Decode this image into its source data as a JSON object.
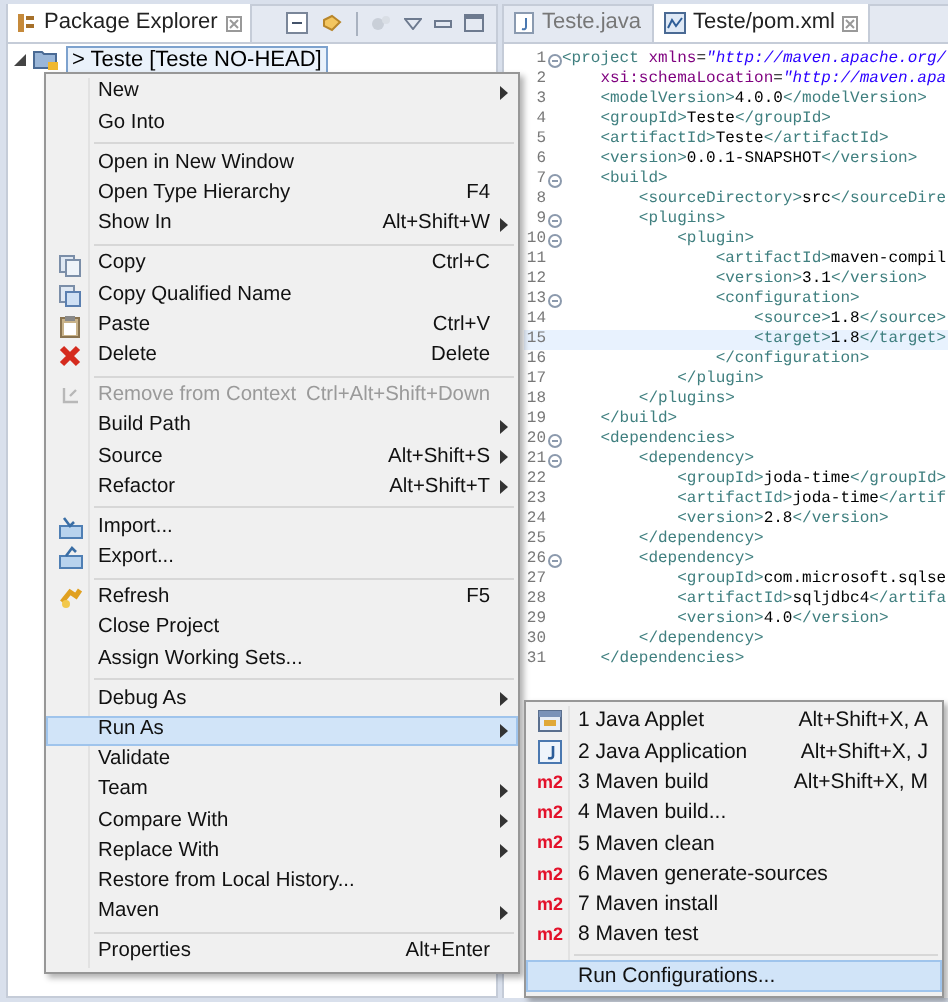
{
  "explorer": {
    "title": "Package Explorer",
    "tree": [
      {
        "label": "> Teste [Teste NO-HEAD]",
        "expanded": true,
        "selected": true
      }
    ]
  },
  "editor": {
    "tabs": [
      {
        "label": "Teste.java",
        "kind": "java",
        "selected": false
      },
      {
        "label": "Teste/pom.xml",
        "kind": "xml",
        "selected": true
      }
    ],
    "lines": [
      {
        "number": "1",
        "fold": true,
        "current": false,
        "tokens": [
          {
            "kind": "tag",
            "text": "<project"
          },
          {
            "kind": "attr",
            "text": " xmlns"
          },
          {
            "kind": "text",
            "text": "="
          },
          {
            "kind": "value",
            "text": "\"http://maven.apache.org/"
          }
        ]
      },
      {
        "number": "2",
        "fold": false,
        "current": false,
        "tokens": [
          {
            "kind": "attr",
            "text": "    xsi:schemaLocation"
          },
          {
            "kind": "text",
            "text": "="
          },
          {
            "kind": "value",
            "text": "\"http://maven.apa"
          }
        ]
      },
      {
        "number": "3",
        "fold": false,
        "current": false,
        "tokens": [
          {
            "kind": "tag",
            "text": "    <modelVersion>"
          },
          {
            "kind": "text",
            "text": "4.0.0"
          },
          {
            "kind": "tag",
            "text": "</modelVersion>"
          }
        ]
      },
      {
        "number": "4",
        "fold": false,
        "current": false,
        "tokens": [
          {
            "kind": "tag",
            "text": "    <groupId>"
          },
          {
            "kind": "text",
            "text": "Teste"
          },
          {
            "kind": "tag",
            "text": "</groupId>"
          }
        ]
      },
      {
        "number": "5",
        "fold": false,
        "current": false,
        "tokens": [
          {
            "kind": "tag",
            "text": "    <artifactId>"
          },
          {
            "kind": "text",
            "text": "Teste"
          },
          {
            "kind": "tag",
            "text": "</artifactId>"
          }
        ]
      },
      {
        "number": "6",
        "fold": false,
        "current": false,
        "tokens": [
          {
            "kind": "tag",
            "text": "    <version>"
          },
          {
            "kind": "text",
            "text": "0.0.1-SNAPSHOT"
          },
          {
            "kind": "tag",
            "text": "</version>"
          }
        ]
      },
      {
        "number": "7",
        "fold": true,
        "current": false,
        "tokens": [
          {
            "kind": "tag",
            "text": "    <build>"
          }
        ]
      },
      {
        "number": "8",
        "fold": false,
        "current": false,
        "tokens": [
          {
            "kind": "tag",
            "text": "        <sourceDirectory>"
          },
          {
            "kind": "text",
            "text": "src"
          },
          {
            "kind": "tag",
            "text": "</sourceDire"
          }
        ]
      },
      {
        "number": "9",
        "fold": true,
        "current": false,
        "tokens": [
          {
            "kind": "tag",
            "text": "        <plugins>"
          }
        ]
      },
      {
        "number": "10",
        "fold": true,
        "current": false,
        "tokens": [
          {
            "kind": "tag",
            "text": "            <plugin>"
          }
        ]
      },
      {
        "number": "11",
        "fold": false,
        "current": false,
        "tokens": [
          {
            "kind": "tag",
            "text": "                <artifactId>"
          },
          {
            "kind": "text",
            "text": "maven-compil"
          }
        ]
      },
      {
        "number": "12",
        "fold": false,
        "current": false,
        "tokens": [
          {
            "kind": "tag",
            "text": "                <version>"
          },
          {
            "kind": "text",
            "text": "3.1"
          },
          {
            "kind": "tag",
            "text": "</version>"
          }
        ]
      },
      {
        "number": "13",
        "fold": true,
        "current": false,
        "tokens": [
          {
            "kind": "tag",
            "text": "                <configuration>"
          }
        ]
      },
      {
        "number": "14",
        "fold": false,
        "current": false,
        "tokens": [
          {
            "kind": "tag",
            "text": "                    <source>"
          },
          {
            "kind": "text",
            "text": "1.8"
          },
          {
            "kind": "tag",
            "text": "</source>"
          }
        ]
      },
      {
        "number": "15",
        "fold": false,
        "current": true,
        "tokens": [
          {
            "kind": "tag",
            "text": "                    <target>"
          },
          {
            "kind": "text",
            "text": "1.8"
          },
          {
            "kind": "tag",
            "text": "</target>"
          }
        ]
      },
      {
        "number": "16",
        "fold": false,
        "current": false,
        "tokens": [
          {
            "kind": "tag",
            "text": "                </configuration>"
          }
        ]
      },
      {
        "number": "17",
        "fold": false,
        "current": false,
        "tokens": [
          {
            "kind": "tag",
            "text": "            </plugin>"
          }
        ]
      },
      {
        "number": "18",
        "fold": false,
        "current": false,
        "tokens": [
          {
            "kind": "tag",
            "text": "        </plugins>"
          }
        ]
      },
      {
        "number": "19",
        "fold": false,
        "current": false,
        "tokens": [
          {
            "kind": "tag",
            "text": "    </build>"
          }
        ]
      },
      {
        "number": "20",
        "fold": true,
        "current": false,
        "tokens": [
          {
            "kind": "tag",
            "text": "    <dependencies>"
          }
        ]
      },
      {
        "number": "21",
        "fold": true,
        "current": false,
        "tokens": [
          {
            "kind": "tag",
            "text": "        <dependency>"
          }
        ]
      },
      {
        "number": "22",
        "fold": false,
        "current": false,
        "tokens": [
          {
            "kind": "tag",
            "text": "            <groupId>"
          },
          {
            "kind": "text",
            "text": "joda-time"
          },
          {
            "kind": "tag",
            "text": "</groupId>"
          }
        ]
      },
      {
        "number": "23",
        "fold": false,
        "current": false,
        "tokens": [
          {
            "kind": "tag",
            "text": "            <artifactId>"
          },
          {
            "kind": "text",
            "text": "joda-time"
          },
          {
            "kind": "tag",
            "text": "</artif"
          }
        ]
      },
      {
        "number": "24",
        "fold": false,
        "current": false,
        "tokens": [
          {
            "kind": "tag",
            "text": "            <version>"
          },
          {
            "kind": "text",
            "text": "2.8"
          },
          {
            "kind": "tag",
            "text": "</version>"
          }
        ]
      },
      {
        "number": "25",
        "fold": false,
        "current": false,
        "tokens": [
          {
            "kind": "tag",
            "text": "        </dependency>"
          }
        ]
      },
      {
        "number": "26",
        "fold": true,
        "current": false,
        "tokens": [
          {
            "kind": "tag",
            "text": "        <dependency>"
          }
        ]
      },
      {
        "number": "27",
        "fold": false,
        "current": false,
        "tokens": [
          {
            "kind": "tag",
            "text": "            <groupId>"
          },
          {
            "kind": "text",
            "text": "com.microsoft.sqlse"
          }
        ]
      },
      {
        "number": "28",
        "fold": false,
        "current": false,
        "tokens": [
          {
            "kind": "tag",
            "text": "            <artifactId>"
          },
          {
            "kind": "text",
            "text": "sqljdbc4"
          },
          {
            "kind": "tag",
            "text": "</artifa"
          }
        ]
      },
      {
        "number": "29",
        "fold": false,
        "current": false,
        "tokens": [
          {
            "kind": "tag",
            "text": "            <version>"
          },
          {
            "kind": "text",
            "text": "4.0"
          },
          {
            "kind": "tag",
            "text": "</version>"
          }
        ]
      },
      {
        "number": "30",
        "fold": false,
        "current": false,
        "tokens": [
          {
            "kind": "tag",
            "text": "        </dependency>"
          }
        ]
      },
      {
        "number": "31",
        "fold": false,
        "current": false,
        "tokens": [
          {
            "kind": "tag",
            "text": "    </dependencies>"
          }
        ]
      }
    ]
  },
  "context_menu": {
    "groups": [
      {
        "items": [
          {
            "label": "New",
            "submenu": true,
            "disabled": false,
            "selected": false
          },
          {
            "label": "Go Into",
            "submenu": false,
            "disabled": false,
            "selected": false
          }
        ]
      },
      {
        "items": [
          {
            "label": "Open in New Window",
            "submenu": false,
            "disabled": false,
            "selected": false
          },
          {
            "label": "Open Type Hierarchy",
            "shortcut": "F4",
            "submenu": false,
            "disabled": false,
            "selected": false
          },
          {
            "label": "Show In",
            "shortcut": "Alt+Shift+W",
            "submenu": true,
            "disabled": false,
            "selected": false
          }
        ]
      },
      {
        "items": [
          {
            "label": "Copy",
            "shortcut": "Ctrl+C",
            "kind": "copy",
            "submenu": false,
            "disabled": false,
            "selected": false
          },
          {
            "label": "Copy Qualified Name",
            "kind": "copy-name",
            "submenu": false,
            "disabled": false,
            "selected": false
          },
          {
            "label": "Paste",
            "shortcut": "Ctrl+V",
            "kind": "paste",
            "submenu": false,
            "disabled": false,
            "selected": false
          },
          {
            "label": "Delete",
            "shortcut": "Delete",
            "kind": "delete",
            "submenu": false,
            "disabled": false,
            "selected": false
          }
        ]
      },
      {
        "items": [
          {
            "label": "Remove from Context",
            "shortcut": "Ctrl+Alt+Shift+Down",
            "kind": "remove",
            "submenu": false,
            "disabled": true,
            "selected": false
          },
          {
            "label": "Build Path",
            "submenu": true,
            "disabled": false,
            "selected": false
          },
          {
            "label": "Source",
            "shortcut": "Alt+Shift+S",
            "submenu": true,
            "disabled": false,
            "selected": false
          },
          {
            "label": "Refactor",
            "shortcut": "Alt+Shift+T",
            "submenu": true,
            "disabled": false,
            "selected": false
          }
        ]
      },
      {
        "items": [
          {
            "label": "Import...",
            "kind": "import",
            "submenu": false,
            "disabled": false,
            "selected": false
          },
          {
            "label": "Export...",
            "kind": "export",
            "submenu": false,
            "disabled": false,
            "selected": false
          }
        ]
      },
      {
        "items": [
          {
            "label": "Refresh",
            "shortcut": "F5",
            "kind": "refresh",
            "submenu": false,
            "disabled": false,
            "selected": false
          },
          {
            "label": "Close Project",
            "submenu": false,
            "disabled": false,
            "selected": false
          },
          {
            "label": "Assign Working Sets...",
            "submenu": false,
            "disabled": false,
            "selected": false
          }
        ]
      },
      {
        "items": [
          {
            "label": "Debug As",
            "submenu": true,
            "disabled": false,
            "selected": false
          },
          {
            "label": "Run As",
            "submenu": true,
            "disabled": false,
            "selected": true
          },
          {
            "label": "Validate",
            "submenu": false,
            "disabled": false,
            "selected": false
          },
          {
            "label": "Team",
            "submenu": true,
            "disabled": false,
            "selected": false
          },
          {
            "label": "Compare With",
            "submenu": true,
            "disabled": false,
            "selected": false
          },
          {
            "label": "Replace With",
            "submenu": true,
            "disabled": false,
            "selected": false
          },
          {
            "label": "Restore from Local History...",
            "submenu": false,
            "disabled": false,
            "selected": false
          },
          {
            "label": "Maven",
            "submenu": true,
            "disabled": false,
            "selected": false
          }
        ]
      },
      {
        "items": [
          {
            "label": "Properties",
            "shortcut": "Alt+Enter",
            "submenu": false,
            "disabled": false,
            "selected": false
          }
        ]
      }
    ]
  },
  "run_as_menu": {
    "groups": [
      {
        "items": [
          {
            "label": "1 Java Applet",
            "shortcut": "Alt+Shift+X, A",
            "kind": "applet",
            "selected": false
          },
          {
            "label": "2 Java Application",
            "shortcut": "Alt+Shift+X, J",
            "kind": "java",
            "selected": false
          },
          {
            "label": "3 Maven build",
            "shortcut": "Alt+Shift+X, M",
            "kind": "maven",
            "badge": "m2",
            "selected": false
          },
          {
            "label": "4 Maven build...",
            "kind": "maven",
            "badge": "m2",
            "selected": false
          },
          {
            "label": "5 Maven clean",
            "kind": "maven",
            "badge": "m2",
            "selected": false
          },
          {
            "label": "6 Maven generate-sources",
            "kind": "maven",
            "badge": "m2",
            "selected": false
          },
          {
            "label": "7 Maven install",
            "kind": "maven",
            "badge": "m2",
            "selected": false
          },
          {
            "label": "8 Maven test",
            "kind": "maven",
            "badge": "m2",
            "selected": false
          }
        ]
      },
      {
        "items": [
          {
            "label": "Run Configurations...",
            "selected": true
          }
        ]
      }
    ]
  }
}
